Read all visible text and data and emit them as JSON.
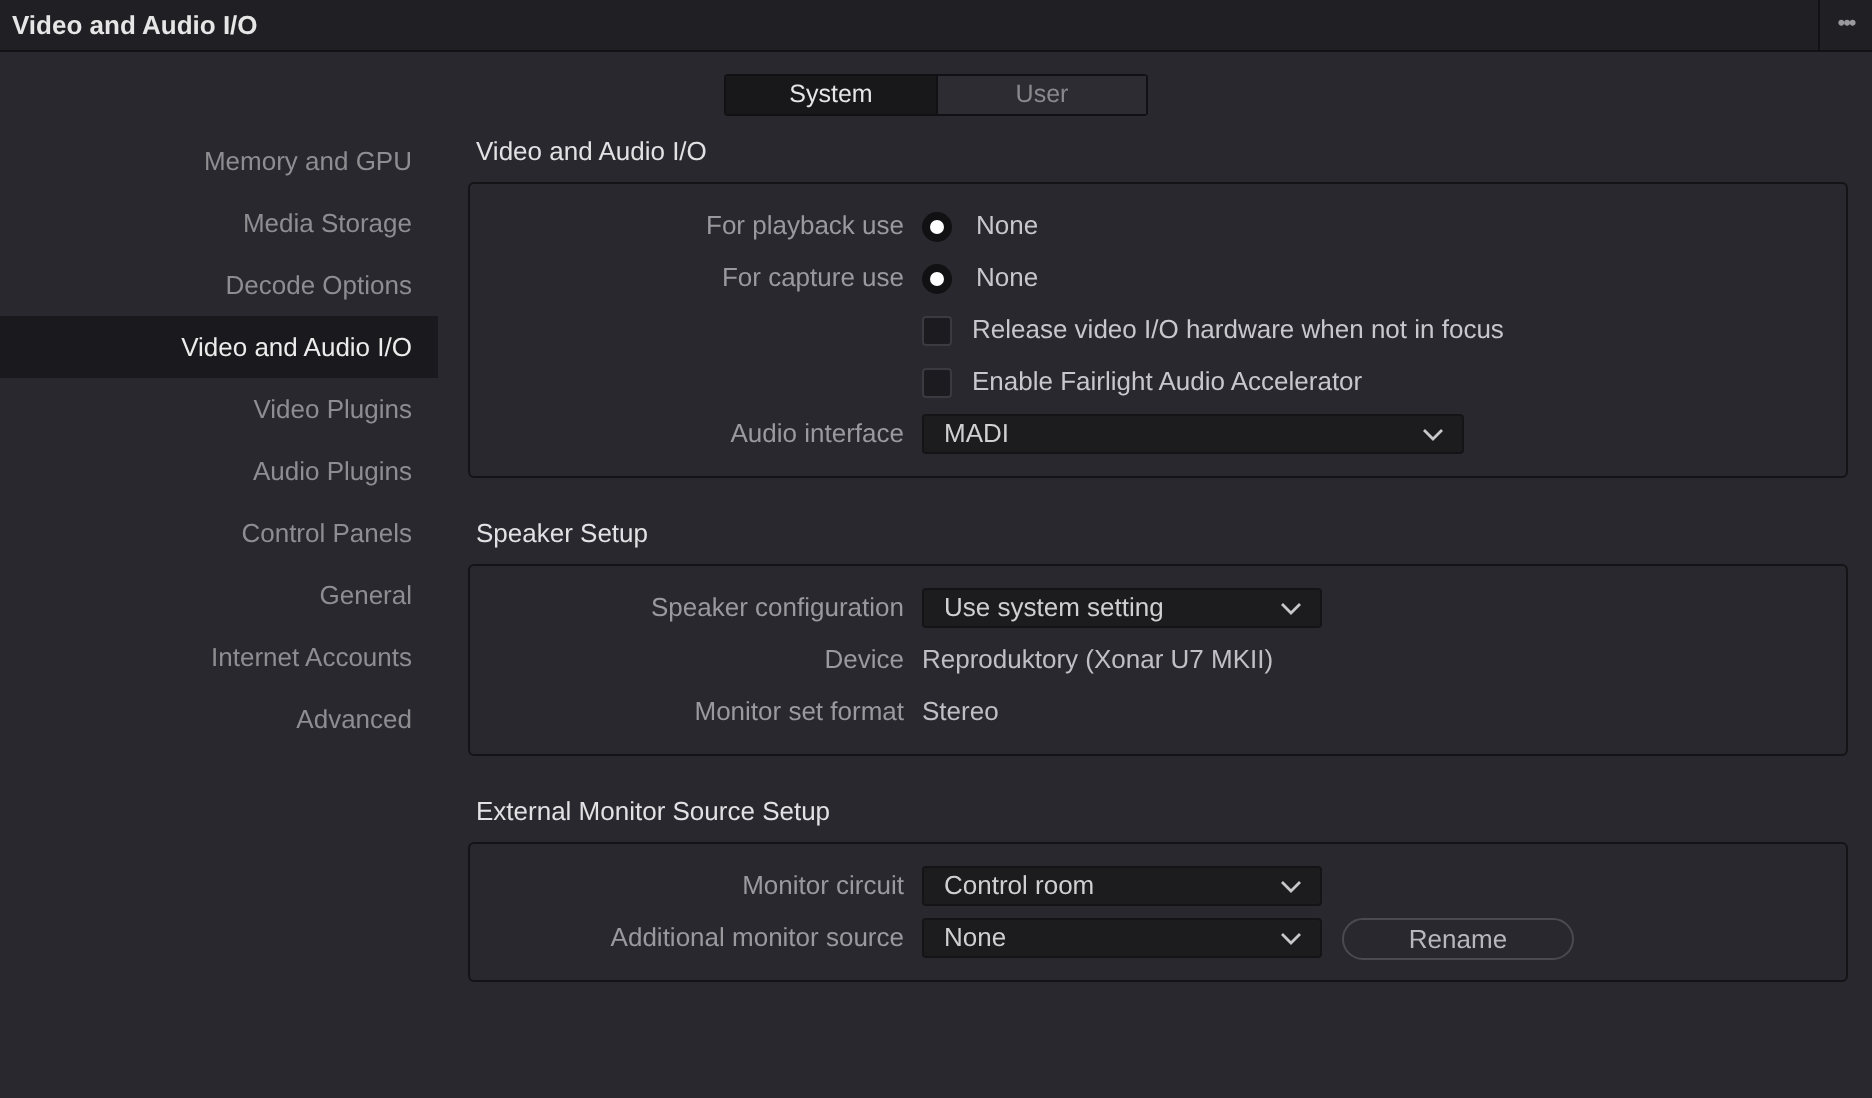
{
  "window": {
    "title": "Video and Audio I/O",
    "menu": "•••"
  },
  "tabs": [
    {
      "label": "System",
      "selected": true
    },
    {
      "label": "User",
      "selected": false
    }
  ],
  "sidebar": {
    "items": [
      {
        "label": "Memory and GPU",
        "selected": false
      },
      {
        "label": "Media Storage",
        "selected": false
      },
      {
        "label": "Decode Options",
        "selected": false
      },
      {
        "label": "Video and Audio I/O",
        "selected": true
      },
      {
        "label": "Video Plugins",
        "selected": false
      },
      {
        "label": "Audio Plugins",
        "selected": false
      },
      {
        "label": "Control Panels",
        "selected": false
      },
      {
        "label": "General",
        "selected": false
      },
      {
        "label": "Internet Accounts",
        "selected": false
      },
      {
        "label": "Advanced",
        "selected": false
      }
    ]
  },
  "sections": [
    {
      "title": "Video and Audio I/O",
      "rows": [
        {
          "kind": "radio",
          "label": "For playback use",
          "value": "None",
          "selected": true
        },
        {
          "kind": "radio",
          "label": "For capture use",
          "value": "None",
          "selected": true
        },
        {
          "kind": "checkbox",
          "value": "Release video I/O hardware when not in focus",
          "checked": false
        },
        {
          "kind": "checkbox",
          "value": "Enable Fairlight Audio Accelerator",
          "checked": false
        },
        {
          "kind": "dropdown",
          "label": "Audio interface",
          "value": "MADI",
          "wide": true
        }
      ]
    },
    {
      "title": "Speaker Setup",
      "rows": [
        {
          "kind": "dropdown",
          "label": "Speaker configuration",
          "value": "Use system setting",
          "wide": false
        },
        {
          "kind": "text",
          "label": "Device",
          "value": "Reproduktory (Xonar U7 MKII)"
        },
        {
          "kind": "text",
          "label": "Monitor set format",
          "value": "Stereo"
        }
      ]
    },
    {
      "title": "External Monitor Source Setup",
      "rows": [
        {
          "kind": "dropdown",
          "label": "Monitor circuit",
          "value": "Control room",
          "wide": false
        },
        {
          "kind": "dropdown",
          "label": "Additional monitor source",
          "value": "None",
          "wide": false,
          "button": "Rename"
        }
      ]
    }
  ]
}
